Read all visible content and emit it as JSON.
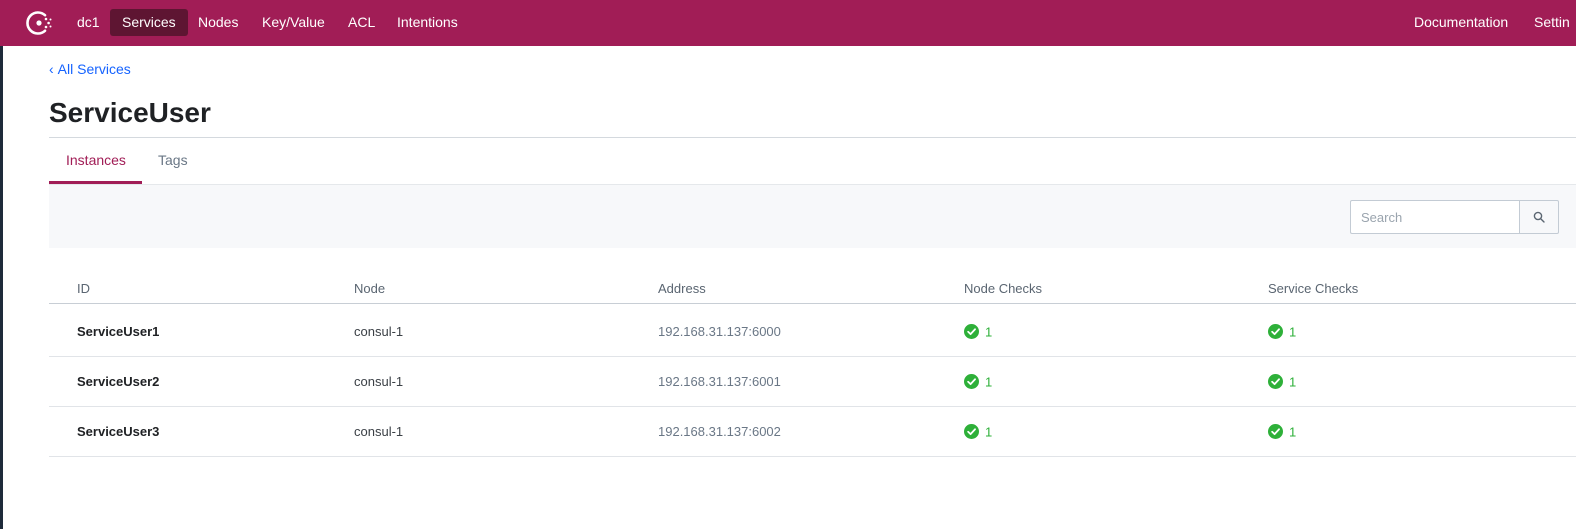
{
  "app": {
    "nav": {
      "datacenter": "dc1",
      "items": [
        "Services",
        "Nodes",
        "Key/Value",
        "ACL",
        "Intentions"
      ],
      "active": "Services",
      "right_items": [
        "Documentation",
        "Settin"
      ]
    },
    "colors": {
      "brand": "#a11d56",
      "brand_dark": "#5e1532",
      "link": "#1563ff",
      "passing": "#2eb039"
    }
  },
  "breadcrumb": {
    "label": "All Services"
  },
  "page": {
    "title": "ServiceUser"
  },
  "tabs": [
    {
      "label": "Instances",
      "active": true
    },
    {
      "label": "Tags",
      "active": false
    }
  ],
  "search": {
    "placeholder": "Search",
    "value": ""
  },
  "table": {
    "columns": [
      "ID",
      "Node",
      "Address",
      "Node Checks",
      "Service Checks"
    ],
    "rows": [
      {
        "id": "ServiceUser1",
        "node": "consul-1",
        "address": "192.168.31.137:6000",
        "node_checks": "1",
        "service_checks": "1"
      },
      {
        "id": "ServiceUser2",
        "node": "consul-1",
        "address": "192.168.31.137:6001",
        "node_checks": "1",
        "service_checks": "1"
      },
      {
        "id": "ServiceUser3",
        "node": "consul-1",
        "address": "192.168.31.137:6002",
        "node_checks": "1",
        "service_checks": "1"
      }
    ]
  },
  "icons": {
    "logo": "consul-logo-icon",
    "breadcrumb": "chevron-left-icon",
    "search": "search-icon",
    "check": "check-circle-icon"
  }
}
